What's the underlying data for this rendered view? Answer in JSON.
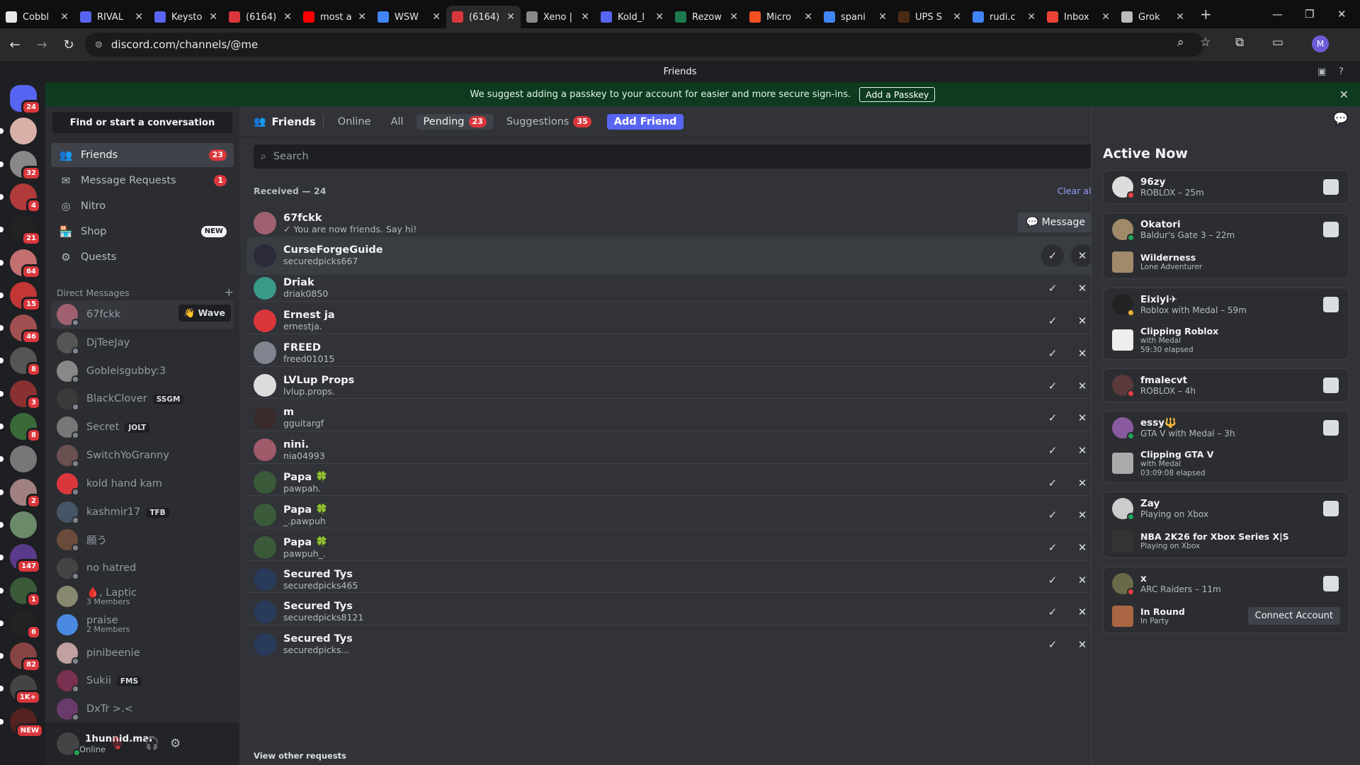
{
  "browser": {
    "tabs": [
      {
        "label": "Cobbl",
        "color": "#e8e8e8"
      },
      {
        "label": "RIVAL",
        "color": "#5865f2"
      },
      {
        "label": "Keysto",
        "color": "#5865f2"
      },
      {
        "label": "(6164)",
        "color": "#da373c"
      },
      {
        "label": "most a",
        "color": "#ff0000"
      },
      {
        "label": "WSW",
        "color": "#4285f4"
      },
      {
        "label": "(6164)",
        "color": "#da373c"
      },
      {
        "label": "Xeno |",
        "color": "#888888"
      },
      {
        "label": "Kold_I",
        "color": "#5865f2"
      },
      {
        "label": "Rezow",
        "color": "#1e7a4e"
      },
      {
        "label": "Micro",
        "color": "#f25022"
      },
      {
        "label": "spani",
        "color": "#4285f4"
      },
      {
        "label": "UPS S",
        "color": "#4d2b13"
      },
      {
        "label": "rudi.c",
        "color": "#4285f4"
      },
      {
        "label": "Inbox",
        "color": "#ea4335"
      },
      {
        "label": "Grok",
        "color": "#bbbbbb"
      }
    ],
    "active_tab_index": 6,
    "url": "discord.com/channels/@me"
  },
  "titlebar": {
    "title": "Friends"
  },
  "servers": [
    {
      "badge": "24",
      "color": "#5865f2"
    },
    {
      "badge": "",
      "color": "#d8b0a8"
    },
    {
      "badge": "32",
      "color": "#888888"
    },
    {
      "badge": "4",
      "color": "#b23a3a"
    },
    {
      "badge": "21",
      "color": "#222222"
    },
    {
      "badge": "64",
      "color": "#c47070"
    },
    {
      "badge": "15",
      "color": "#c23636"
    },
    {
      "badge": "46",
      "color": "#a05050"
    },
    {
      "badge": "8",
      "color": "#555555"
    },
    {
      "badge": "3",
      "color": "#8a3030"
    },
    {
      "badge": "8",
      "color": "#3a6a3a"
    },
    {
      "badge": "",
      "color": "#777777"
    },
    {
      "badge": "2",
      "color": "#a08080"
    },
    {
      "badge": "",
      "color": "#6a8a6a"
    },
    {
      "badge": "147",
      "color": "#5a3a8a"
    },
    {
      "badge": "1",
      "color": "#3a5a3a"
    },
    {
      "badge": "6",
      "color": "#222222"
    },
    {
      "badge": "82",
      "color": "#884444"
    },
    {
      "badge": "1K+",
      "color": "#444444"
    },
    {
      "badge": "NEW",
      "color": "#552222"
    }
  ],
  "passkey": {
    "text": "We suggest adding a passkey to your account for easier and more secure sign-ins.",
    "button": "Add a Passkey"
  },
  "dm": {
    "find": "Find or start a conversation",
    "nav": [
      {
        "label": "Friends",
        "badge": "23",
        "icon": "👥"
      },
      {
        "label": "Message Requests",
        "badge": "1",
        "icon": "✉"
      },
      {
        "label": "Nitro",
        "badge": "",
        "icon": "◎"
      },
      {
        "label": "Shop",
        "badge": "NEW",
        "icon": "🏪"
      },
      {
        "label": "Quests",
        "badge": "",
        "icon": "⚙"
      }
    ],
    "header": "Direct Messages",
    "header_plus": "+",
    "wave": "👋 Wave",
    "list": [
      {
        "name": "67fckk",
        "sub": "",
        "tag": "",
        "color": "#a06070"
      },
      {
        "name": "DjTeeJay",
        "sub": "",
        "tag": "",
        "color": "#555555"
      },
      {
        "name": "Gobleisgubby:3",
        "sub": "",
        "tag": "",
        "color": "#888888"
      },
      {
        "name": "BlackClover",
        "sub": "",
        "tag": "SSGM",
        "color": "#3a3a3a"
      },
      {
        "name": "Secret",
        "sub": "",
        "tag": "JOLT",
        "color": "#777777"
      },
      {
        "name": "SwitchYoGranny",
        "sub": "",
        "tag": "",
        "color": "#6a5050"
      },
      {
        "name": "kold hand kam",
        "sub": "",
        "tag": "",
        "color": "#da373c"
      },
      {
        "name": "kashmir17",
        "sub": "",
        "tag": "TFB",
        "color": "#445566"
      },
      {
        "name": "願う",
        "sub": "",
        "tag": "",
        "color": "#6a4a3a"
      },
      {
        "name": "no hatred",
        "sub": "",
        "tag": "",
        "color": "#444444"
      },
      {
        "name": "🩸, Laptic",
        "sub": "3 Members",
        "tag": "",
        "color": "#888870"
      },
      {
        "name": "praise",
        "sub": "2 Members",
        "tag": "",
        "color": "#4a8ae0"
      },
      {
        "name": "pinibeenie",
        "sub": "",
        "tag": "",
        "color": "#c0a0a0"
      },
      {
        "name": "Sukii",
        "sub": "",
        "tag": "FMS",
        "color": "#7a3050"
      },
      {
        "name": "DxTr >.<",
        "sub": "",
        "tag": "",
        "color": "#6a3a6a"
      }
    ]
  },
  "user": {
    "name": "1hunnid.mar",
    "status": "Online"
  },
  "main": {
    "title": "Friends",
    "tabs": [
      {
        "label": "Online",
        "count": ""
      },
      {
        "label": "All",
        "count": ""
      },
      {
        "label": "Pending",
        "count": "23"
      },
      {
        "label": "Suggestions",
        "count": "35"
      }
    ],
    "add_friend": "Add Friend",
    "search_placeholder": "Search",
    "received": "Received — 24",
    "clear_all": "Clear all",
    "view_other": "View other requests",
    "rows": [
      {
        "name": "67fckk",
        "sub": "✓  You are now friends. Say hi!",
        "type": "friend",
        "color": "#a06070"
      },
      {
        "name": "CurseForgeGuide",
        "sub": "securedpicks667",
        "type": "pending",
        "color": "#2a2a3a"
      },
      {
        "name": "Driak",
        "sub": "driak0850",
        "type": "pending",
        "color": "#3a9a8a"
      },
      {
        "name": "Ernest ja",
        "sub": "ernestja.",
        "type": "pending",
        "color": "#da373c"
      },
      {
        "name": "FREED",
        "sub": "freed01015",
        "type": "pending",
        "color": "#80848e"
      },
      {
        "name": "LVLup Props",
        "sub": "lvlup.props.",
        "type": "pending",
        "color": "#dddddd"
      },
      {
        "name": "m",
        "sub": "gguitargf",
        "type": "pending",
        "color": "#3a2a2a"
      },
      {
        "name": "nini.",
        "sub": "nia04993",
        "type": "pending",
        "color": "#a05a6a"
      },
      {
        "name": "Papa 🍀",
        "sub": "pawpah.",
        "type": "pending",
        "color": "#3a5a3a"
      },
      {
        "name": "Papa 🍀",
        "sub": "_.pawpuh",
        "type": "pending",
        "color": "#3a5a3a"
      },
      {
        "name": "Papa 🍀",
        "sub": "pawpuh_.",
        "type": "pending",
        "color": "#3a5a3a"
      },
      {
        "name": "Secured Tys",
        "sub": "securedpicks465",
        "type": "pending",
        "color": "#2a3a5a"
      },
      {
        "name": "Secured Tys",
        "sub": "securedpicks8121",
        "type": "pending",
        "color": "#2a3a5a"
      },
      {
        "name": "Secured Tys",
        "sub": "securedpicks...",
        "type": "pending",
        "color": "#2a3a5a"
      }
    ],
    "message_label": "Message"
  },
  "active": {
    "title": "Active Now",
    "connect": "Connect Account",
    "cards": [
      {
        "lines": [
          {
            "kind": "user",
            "name": "96zy",
            "sub": "ROBLOX – 25m",
            "status": "#f23f43",
            "color": "#dddddd",
            "game": true
          }
        ]
      },
      {
        "lines": [
          {
            "kind": "user",
            "name": "Okatori",
            "sub": "Baldur's Gate 3 – 22m",
            "status": "#23a55a",
            "color": "#a08a6a",
            "game": true
          },
          {
            "kind": "act",
            "name": "Wilderness",
            "sub": "Lone Adventurer",
            "sub2": "",
            "color": "#a08a6a"
          }
        ]
      },
      {
        "lines": [
          {
            "kind": "user",
            "name": "Eixiyi✈",
            "sub": "Roblox with Medal – 59m",
            "status": "#f0b232",
            "color": "#222222",
            "game": true
          },
          {
            "kind": "act",
            "name": "Clipping Roblox",
            "sub": "with Medal",
            "sub2": "59:30 elapsed",
            "color": "#eeeeee"
          }
        ]
      },
      {
        "lines": [
          {
            "kind": "user",
            "name": "fmalecvt",
            "sub": "ROBLOX – 4h",
            "status": "#f23f43",
            "color": "#5a3a3a",
            "game": true
          }
        ]
      },
      {
        "lines": [
          {
            "kind": "user",
            "name": "essy🔱",
            "sub": "GTA V with Medal – 3h",
            "status": "#23a55a",
            "color": "#8a5aa0",
            "game": true
          },
          {
            "kind": "act",
            "name": "Clipping GTA V",
            "sub": "with Medal",
            "sub2": "03:09:08 elapsed",
            "color": "#aaaaaa"
          }
        ]
      },
      {
        "lines": [
          {
            "kind": "user",
            "name": "Zay",
            "sub": "Playing on Xbox",
            "status": "#23a55a",
            "color": "#cccccc",
            "game": true
          },
          {
            "kind": "act",
            "name": "NBA 2K26 for Xbox Series X|S",
            "sub": "Playing on Xbox",
            "sub2": "",
            "color": "#333333"
          }
        ]
      },
      {
        "lines": [
          {
            "kind": "user",
            "name": "x",
            "sub": "ARC Raiders – 11m",
            "status": "#f23f43",
            "color": "#6a6a4a",
            "game": true
          },
          {
            "kind": "act",
            "name": "In Round",
            "sub": "In Party",
            "sub2": "",
            "color": "#aa6644",
            "connect": true
          }
        ]
      }
    ]
  }
}
